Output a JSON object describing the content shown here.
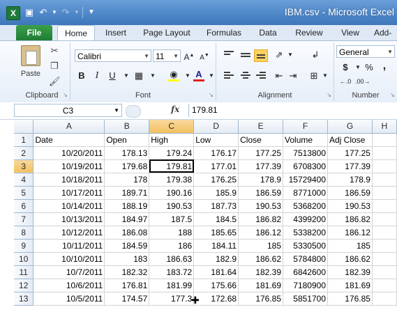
{
  "window": {
    "title": "IBM.csv - Microsoft Excel",
    "app_icon": "X"
  },
  "qat": {
    "icons": [
      "save-icon",
      "undo-icon",
      "redo-icon",
      "customize-qat-icon"
    ]
  },
  "ribbon_tabs": [
    "File",
    "Home",
    "Insert",
    "Page Layout",
    "Formulas",
    "Data",
    "Review",
    "View",
    "Add-"
  ],
  "clipboard": {
    "paste_label": "Paste",
    "group_label": "Clipboard"
  },
  "font": {
    "name": "Calibri",
    "size": "11",
    "bold": "B",
    "italic": "I",
    "underline": "U",
    "font_color_letter": "A",
    "group_label": "Font",
    "highlight_color": "#ffff00",
    "font_color": "#e02020"
  },
  "alignment": {
    "group_label": "Alignment"
  },
  "number": {
    "format": "General",
    "currency": "$",
    "percent": "%",
    "comma": ",",
    "group_label": "Number"
  },
  "formula_bar": {
    "name_box": "C3",
    "fx": "fx",
    "value": "179.81"
  },
  "sheet": {
    "columns": [
      "A",
      "B",
      "C",
      "D",
      "E",
      "F",
      "G",
      "H"
    ],
    "active_cell": "C3",
    "headers": [
      "Date",
      "Open",
      "High",
      "Low",
      "Close",
      "Volume",
      "Adj Close"
    ],
    "rows": [
      [
        "10/20/2011",
        "178.13",
        "179.24",
        "176.17",
        "177.25",
        "7513800",
        "177.25"
      ],
      [
        "10/19/2011",
        "179.68",
        "179.81",
        "177.01",
        "177.39",
        "6708300",
        "177.39"
      ],
      [
        "10/18/2011",
        "178",
        "179.38",
        "176.25",
        "178.9",
        "15729400",
        "178.9"
      ],
      [
        "10/17/2011",
        "189.71",
        "190.16",
        "185.9",
        "186.59",
        "8771000",
        "186.59"
      ],
      [
        "10/14/2011",
        "188.19",
        "190.53",
        "187.73",
        "190.53",
        "5368200",
        "190.53"
      ],
      [
        "10/13/2011",
        "184.97",
        "187.5",
        "184.5",
        "186.82",
        "4399200",
        "186.82"
      ],
      [
        "10/12/2011",
        "186.08",
        "188",
        "185.65",
        "186.12",
        "5338200",
        "186.12"
      ],
      [
        "10/11/2011",
        "184.59",
        "186",
        "184.11",
        "185",
        "5330500",
        "185"
      ],
      [
        "10/10/2011",
        "183",
        "186.63",
        "182.9",
        "186.62",
        "5784800",
        "186.62"
      ],
      [
        "10/7/2011",
        "182.32",
        "183.72",
        "181.64",
        "182.39",
        "6842600",
        "182.39"
      ],
      [
        "10/6/2011",
        "176.81",
        "181.99",
        "175.66",
        "181.69",
        "7180900",
        "181.69"
      ],
      [
        "10/5/2011",
        "174.57",
        "177.3",
        "172.68",
        "176.85",
        "5851700",
        "176.85"
      ]
    ]
  }
}
